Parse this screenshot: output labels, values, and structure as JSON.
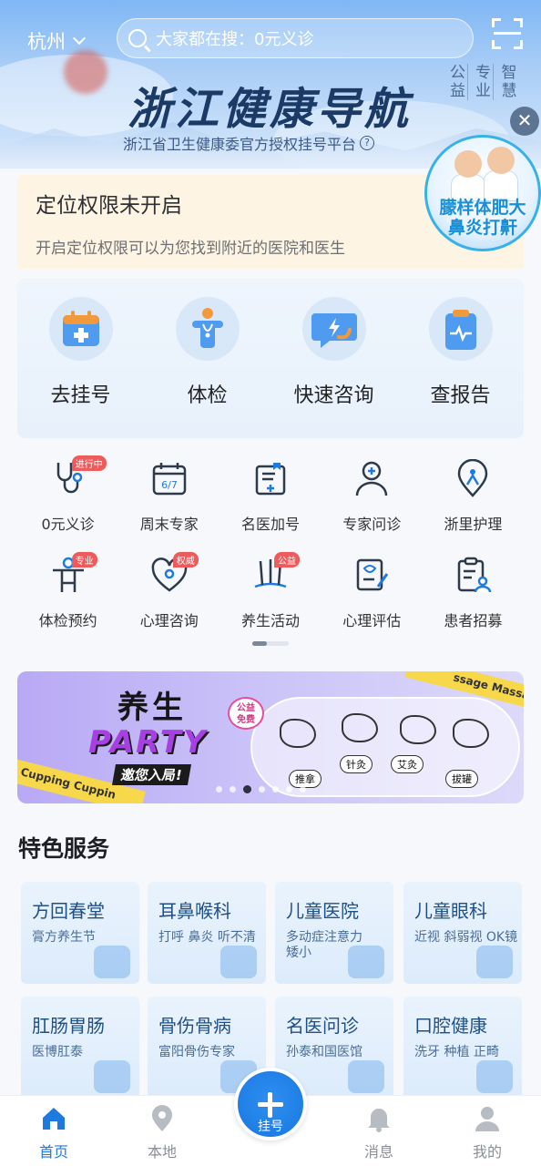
{
  "header": {
    "city": "杭州",
    "search_placeholder": "大家都在搜：0元义诊",
    "brand": "浙江健康导航",
    "brand_sub": "浙江省卫生健康委官方授权挂号平台",
    "motto": [
      "公益",
      "专业",
      "智慧"
    ]
  },
  "float_ad": {
    "text_line1": "朦样体肥大",
    "text_line2": "鼻炎打鼾"
  },
  "location_notice": {
    "title": "定位权限未开启",
    "desc": "开启定位权限可以为您找到附近的医院和医生"
  },
  "main_functions": [
    {
      "label": "去挂号",
      "icon": "calendar-plus-icon"
    },
    {
      "label": "体检",
      "icon": "person-stethoscope-icon"
    },
    {
      "label": "快速咨询",
      "icon": "chat-lightning-icon"
    },
    {
      "label": "查报告",
      "icon": "clipboard-report-icon"
    }
  ],
  "services": [
    {
      "label": "0元义诊",
      "icon": "stethoscope-icon",
      "badge": "进行中"
    },
    {
      "label": "周末专家",
      "icon": "calendar-6-7-icon",
      "badge": ""
    },
    {
      "label": "名医加号",
      "icon": "medical-kit-icon",
      "badge": ""
    },
    {
      "label": "专家问诊",
      "icon": "doctor-icon",
      "badge": ""
    },
    {
      "label": "浙里护理",
      "icon": "nurse-pin-icon",
      "badge": ""
    },
    {
      "label": "体检预约",
      "icon": "body-check-icon",
      "badge": "专业"
    },
    {
      "label": "心理咨询",
      "icon": "heart-mind-icon",
      "badge": "权威"
    },
    {
      "label": "养生活动",
      "icon": "acupuncture-icon",
      "badge": "公益"
    },
    {
      "label": "心理评估",
      "icon": "assessment-icon",
      "badge": ""
    },
    {
      "label": "患者招募",
      "icon": "recruit-icon",
      "badge": ""
    }
  ],
  "banner": {
    "title": "养生",
    "party": "PARTY",
    "invite": "邀您入局!",
    "gongyi": [
      "公益",
      "免费"
    ],
    "tags": [
      "推拿",
      "针灸",
      "艾灸",
      "拔罐"
    ],
    "stripe_left": "Cupping   Cuppin",
    "stripe_right": "ssage   Massage",
    "page_count": 7,
    "active_page": 3
  },
  "featured": {
    "title": "特色服务",
    "cards": [
      {
        "title": "方回春堂",
        "desc": "膏方养生节"
      },
      {
        "title": "耳鼻喉科",
        "desc": "打呼 鼻炎 听不清"
      },
      {
        "title": "儿童医院",
        "desc": "多动症注意力\n矮小"
      },
      {
        "title": "儿童眼科",
        "desc": "近视 斜弱视 OK镜"
      },
      {
        "title": "肛肠胃肠",
        "desc": "医博肛泰"
      },
      {
        "title": "骨伤骨病",
        "desc": "富阳骨伤专家"
      },
      {
        "title": "名医问诊",
        "desc": "孙泰和国医馆"
      },
      {
        "title": "口腔健康",
        "desc": "洗牙 种植 正畸"
      }
    ]
  },
  "tabbar": {
    "home": "首页",
    "local": "本地",
    "register": "挂号",
    "messages": "消息",
    "mine": "我的"
  },
  "colors": {
    "accent": "#1f7ae0",
    "badge": "#ef5b5b",
    "notice_bg": "#fdf4e3"
  }
}
